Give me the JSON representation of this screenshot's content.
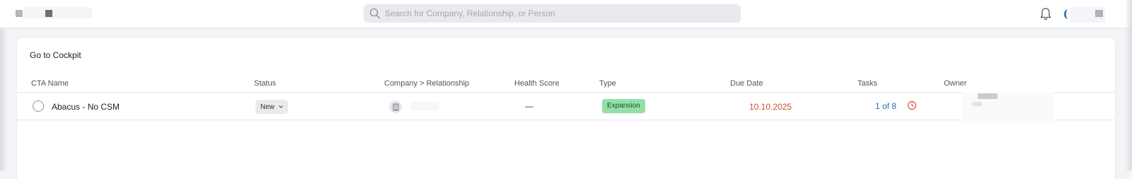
{
  "header": {
    "search": {
      "placeholder": "Search for Company, Relationship, or Person",
      "value": ""
    },
    "icons": {
      "search": "search-icon",
      "notifications": "bell-icon",
      "avatar": "user-avatar"
    }
  },
  "card": {
    "title": "Go to Cockpit",
    "columns": [
      "CTA Name",
      "Status",
      "Company > Relationship",
      "Health Score",
      "Type",
      "Due Date",
      "Tasks",
      "Owner"
    ],
    "rows": [
      {
        "cta_name": "Abacus - No CSM",
        "status": "New",
        "company_icon": "building-icon",
        "health_score": "—",
        "type": "Expansion",
        "due_date": "10.10.2025",
        "tasks": "1 of 8",
        "tasks_icon": "clock-icon"
      }
    ]
  },
  "colors": {
    "accent_blue": "#2b6cb3",
    "due_date_red": "#c4552f",
    "expansion_badge": "#92e0a8",
    "overdue_icon": "#d9534f"
  }
}
